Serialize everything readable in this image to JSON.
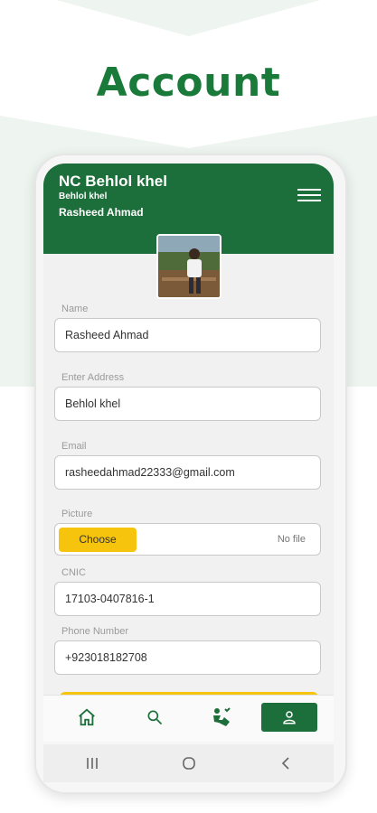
{
  "page": {
    "headline": "Account"
  },
  "header": {
    "title": "NC Behlol khel",
    "subtitle": "Behlol khel",
    "user_name": "Rasheed Ahmad",
    "menu_icon": "hamburger-menu-icon"
  },
  "profile": {
    "avatar_icon": "profile-photo"
  },
  "form": {
    "name": {
      "label": "Name",
      "value": "Rasheed Ahmad"
    },
    "address": {
      "label": "Enter Address",
      "value": "Behlol khel"
    },
    "email": {
      "label": "Email",
      "value": "rasheedahmad22333@gmail.com"
    },
    "picture": {
      "label": "Picture",
      "button": "Choose",
      "status": "No file"
    },
    "cnic": {
      "label": "CNIC",
      "value": "17103-0407816-1"
    },
    "phone": {
      "label": "Phone Number",
      "value": "+923018182708"
    }
  },
  "bottom_nav": {
    "items": [
      {
        "icon": "home-icon"
      },
      {
        "icon": "search-icon"
      },
      {
        "icon": "volunteer-icon"
      },
      {
        "icon": "person-icon",
        "active": true
      }
    ]
  },
  "system_nav": {
    "items": [
      "recents-icon",
      "home-circle-icon",
      "back-icon"
    ]
  },
  "colors": {
    "primary": "#1c6e3a",
    "accent": "#f7c40d",
    "headline": "#1a7a3a"
  }
}
